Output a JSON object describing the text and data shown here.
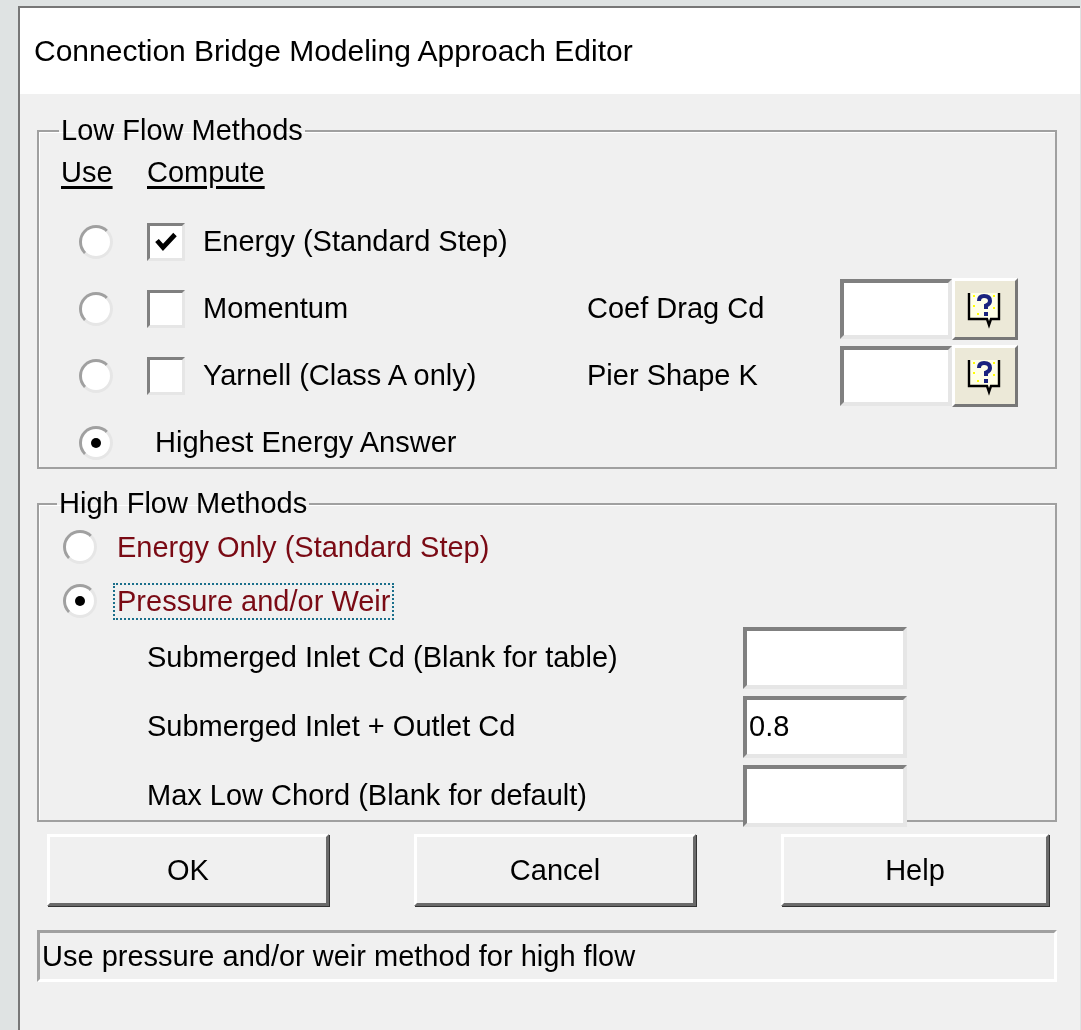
{
  "window": {
    "title": "Connection Bridge Modeling Approach Editor"
  },
  "low_flow": {
    "title": "Low Flow Methods",
    "headers": [
      "Use",
      "Compute"
    ],
    "methods": [
      {
        "kind": "compute",
        "label": "Energy (Standard Step)",
        "selected": false,
        "checked": true
      },
      {
        "kind": "compute",
        "label": "Momentum",
        "selected": false,
        "checked": false,
        "param": {
          "label": "Coef Drag Cd"
        }
      },
      {
        "kind": "compute",
        "label": "Yarnell (Class A only)",
        "selected": false,
        "checked": false,
        "param": {
          "label": "Pier Shape K"
        }
      },
      {
        "kind": "answer",
        "label": "Highest Energy Answer",
        "selected": true
      }
    ]
  },
  "high_flow": {
    "title": "High Flow Methods",
    "options": [
      {
        "label": "Energy Only (Standard Step)",
        "selected": false,
        "focused": false
      },
      {
        "label": "Pressure and/or Weir",
        "selected": true,
        "focused": true
      }
    ],
    "fields": [
      {
        "label": "Submerged Inlet Cd (Blank for table)"
      },
      {
        "label": "Submerged Inlet + Outlet Cd",
        "value": "0.8"
      },
      {
        "label": "Max Low Chord (Blank for default)"
      }
    ]
  },
  "buttons": [
    "OK",
    "Cancel",
    "Help"
  ],
  "status_bar": "Use pressure and/or weir method for high flow"
}
